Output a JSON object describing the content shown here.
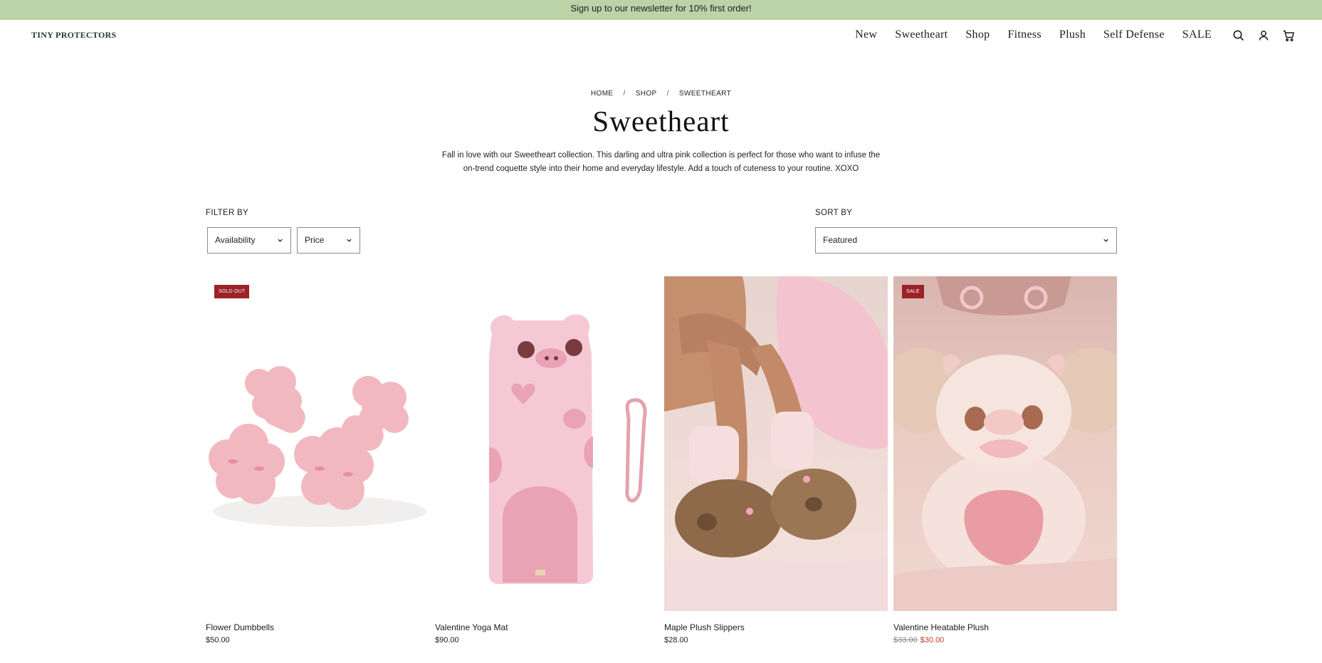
{
  "announcement": "Sign up to our newsletter for 10% first order!",
  "header": {
    "logo": "TINY PROTECTORS",
    "nav": [
      "New",
      "Sweetheart",
      "Shop",
      "Fitness",
      "Plush",
      "Self Defense",
      "SALE"
    ]
  },
  "breadcrumb": [
    "HOME",
    "SHOP",
    "SWEETHEART"
  ],
  "page_title": "Sweetheart",
  "description_line1": "Fall in love with our Sweetheart collection. This darling and ultra pink collection is perfect for those who want to infuse the",
  "description_line2": "on-trend coquette style into their home and everyday lifestyle. Add a touch of cuteness to your routine. XOXO",
  "filter": {
    "label": "FILTER BY",
    "availability": "Availability",
    "price": "Price"
  },
  "sort": {
    "label": "SORT BY",
    "value": "Featured"
  },
  "products": [
    {
      "name": "Flower Dumbbells",
      "price": "$50.00",
      "badge": "SOLD OUT"
    },
    {
      "name": "Valentine Yoga Mat",
      "price": "$90.00"
    },
    {
      "name": "Maple Plush Slippers",
      "price": "$28.00"
    },
    {
      "name": "Valentine Heatable Plush",
      "old_price": "$33.00",
      "sale_price": "$30.00",
      "badge": "SALE"
    }
  ],
  "colors": {
    "announcement_bg": "#bcd3a8",
    "badge_bg": "#9b2226",
    "sale_price": "#c0392b"
  }
}
